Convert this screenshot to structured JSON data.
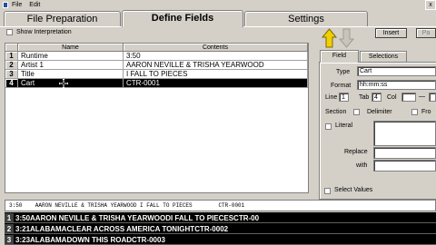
{
  "menu": [
    "File",
    "Edit"
  ],
  "close_glyph": "x",
  "tabs": [
    {
      "label": "File Preparation"
    },
    {
      "label": "Define Fields"
    },
    {
      "label": "Settings"
    }
  ],
  "show_interpretation": "Show Interpretation",
  "grid": {
    "headers": {
      "name": "Name",
      "contents": "Contents"
    },
    "rows": [
      {
        "num": "1",
        "name": "Runtime",
        "contents": "3:50"
      },
      {
        "num": "2",
        "name": "Artist 1",
        "contents": "AARON NEVILLE & TRISHA YEARWOOD"
      },
      {
        "num": "3",
        "name": "Title",
        "contents": "I FALL TO PIECES"
      },
      {
        "num": "4",
        "name": "Cart",
        "contents": "CTR-0001"
      }
    ]
  },
  "toolbar": {
    "insert": "Insert",
    "paste": "Pa"
  },
  "subtabs": [
    "Field",
    "Selections"
  ],
  "field_panel": {
    "type_label": "Type",
    "type_value": "Cart",
    "format_label": "Format",
    "format_value": "hh:mm:ss",
    "line_label": "Line",
    "line_value": "1",
    "tab_label": "Tab",
    "tab_value": "4",
    "col_label": "Col",
    "section_label": "Section",
    "delimiter_label": "Delimiter",
    "fro_label": "Fro",
    "literal_label": "Literal",
    "replace_label": "Replace",
    "with_label": "with",
    "select_values_label": "Select Values"
  },
  "preview_line": "3:50    AARON NEVILLE & TRISHA YEARWOOD I FALL TO PIECES        CTR-0001",
  "results": [
    {
      "num": "1",
      "text": "3:50AARON NEVILLE & TRISHA YEARWOODI FALL TO PIECESCTR-00"
    },
    {
      "num": "2",
      "text": "3:21ALABAMACLEAR ACROSS AMERICA TONIGHTCTR-0002"
    },
    {
      "num": "3",
      "text": "3:23ALABAMADOWN THIS ROADCTR-0003"
    }
  ],
  "colors": {
    "selected_row": "#000000",
    "window": "#d4d0c8",
    "arrow_yellow": "#f0d000"
  },
  "icons": [
    "app-logo-icon",
    "arrow-up-icon",
    "arrow-down-icon",
    "cursor-icon"
  ]
}
